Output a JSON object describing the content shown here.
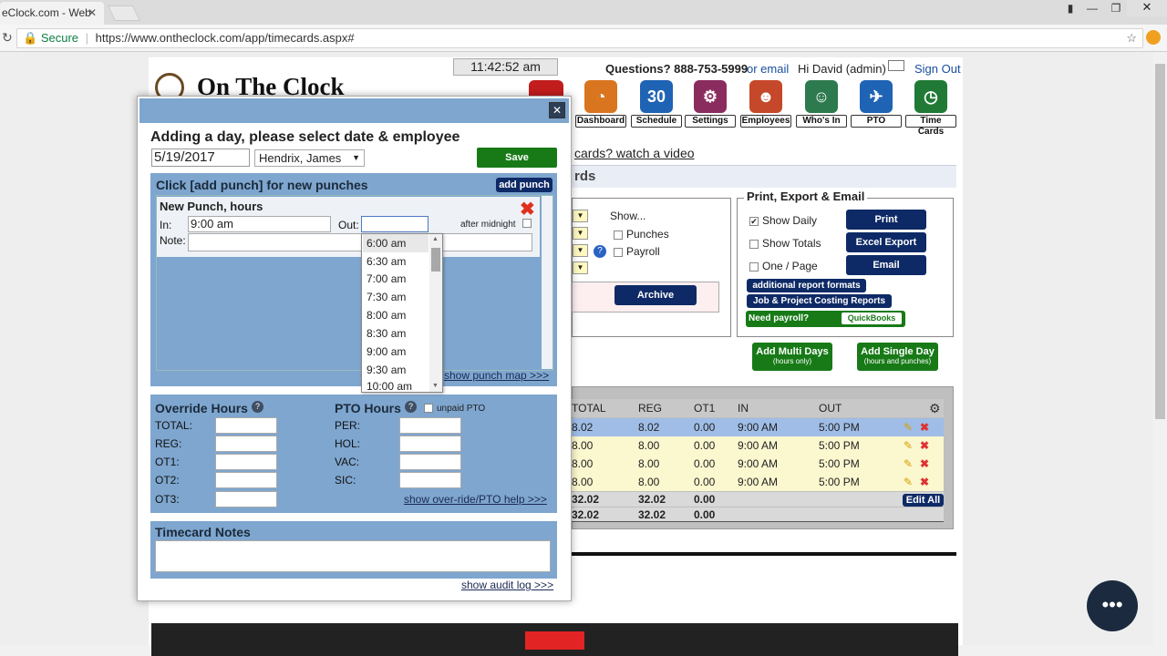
{
  "browser": {
    "tab_title": "eClock.com - Web",
    "secure_label": "Secure",
    "url": "https://www.ontheclock.com/app/timecards.aspx#"
  },
  "header": {
    "logo": "On The Clock",
    "clock": "11:42:52 am",
    "questions": "Questions? 888-753-5999",
    "or_email": "or email",
    "greeting": "Hi David (admin)",
    "sign_out": "Sign Out"
  },
  "nav": [
    {
      "label": "Dashboard",
      "icon": "dashboard-icon",
      "color": "#d9751f"
    },
    {
      "label": "Schedule",
      "icon": "calendar-icon",
      "color": "#1f63b5",
      "glyph": "30"
    },
    {
      "label": "Settings",
      "icon": "gears-icon",
      "color": "#8b2c5e"
    },
    {
      "label": "Employees",
      "icon": "employees-icon",
      "color": "#c6482a"
    },
    {
      "label": "Who's In",
      "icon": "people-icon",
      "color": "#2e7a4f"
    },
    {
      "label": "PTO",
      "icon": "plane-icon",
      "color": "#1f63b5"
    },
    {
      "label": "Time Cards",
      "icon": "clock-icon",
      "color": "#207a35"
    }
  ],
  "background": {
    "watch_video": "cards? watch a video",
    "section_title": "rds",
    "show_label": "Show...",
    "show_punches": "Punches",
    "show_payroll": "Payroll",
    "archive": "Archive",
    "print_title": "Print, Export & Email",
    "show_daily": "Show Daily",
    "show_totals": "Show Totals",
    "one_page": "One / Page",
    "print": "Print",
    "excel_export": "Excel Export",
    "email": "Email",
    "additional_formats": "additional report formats",
    "job_costing": "Job & Project Costing Reports",
    "need_payroll": "Need payroll?",
    "quickbooks": "QuickBooks",
    "add_multi": "Add Multi Days",
    "add_multi_sub": "(hours only)",
    "add_single": "Add Single Day",
    "add_single_sub": "(hours and punches)",
    "edit_all": "Edit All"
  },
  "table": {
    "headers": [
      "TOTAL",
      "REG",
      "OT1",
      "IN",
      "OUT"
    ],
    "rows": [
      {
        "total": "8.02",
        "reg": "8.02",
        "ot1": "0.00",
        "in": "9:00 AM",
        "out": "5:00 PM"
      },
      {
        "total": "8.00",
        "reg": "8.00",
        "ot1": "0.00",
        "in": "9:00 AM",
        "out": "5:00 PM"
      },
      {
        "total": "8.00",
        "reg": "8.00",
        "ot1": "0.00",
        "in": "9:00 AM",
        "out": "5:00 PM"
      },
      {
        "total": "8.00",
        "reg": "8.00",
        "ot1": "0.00",
        "in": "9:00 AM",
        "out": "5:00 PM"
      }
    ],
    "totals": [
      {
        "total": "32.02",
        "reg": "32.02",
        "ot1": "0.00"
      },
      {
        "total": "32.02",
        "reg": "32.02",
        "ot1": "0.00"
      }
    ]
  },
  "modal": {
    "title": "Adding a day, please select date & employee",
    "date": "5/19/2017",
    "employee": "Hendrix, James",
    "save": "Save",
    "punch_header": "Click [add punch] for new punches",
    "add_punch": "add punch",
    "new_punch": "New Punch, hours",
    "in_label": "In:",
    "in_value": "9:00 am",
    "out_label": "Out:",
    "after_midnight": "after midnight",
    "note_label": "Note:",
    "show_punch_map": "show punch map >>>",
    "override_title": "Override Hours",
    "override_fields": [
      "TOTAL:",
      "REG:",
      "OT1:",
      "OT2:",
      "OT3:"
    ],
    "pto_title": "PTO Hours",
    "unpaid_pto": "unpaid PTO",
    "pto_fields": [
      "PER:",
      "HOL:",
      "VAC:",
      "SIC:"
    ],
    "override_help": "show over-ride/PTO help >>>",
    "notes_title": "Timecard Notes",
    "audit_log": "show audit log >>>"
  },
  "dropdown": {
    "options": [
      "6:00 am",
      "6:30 am",
      "7:00 am",
      "7:30 am",
      "8:00 am",
      "8:30 am",
      "9:00 am",
      "9:30 am",
      "10:00 am"
    ]
  }
}
